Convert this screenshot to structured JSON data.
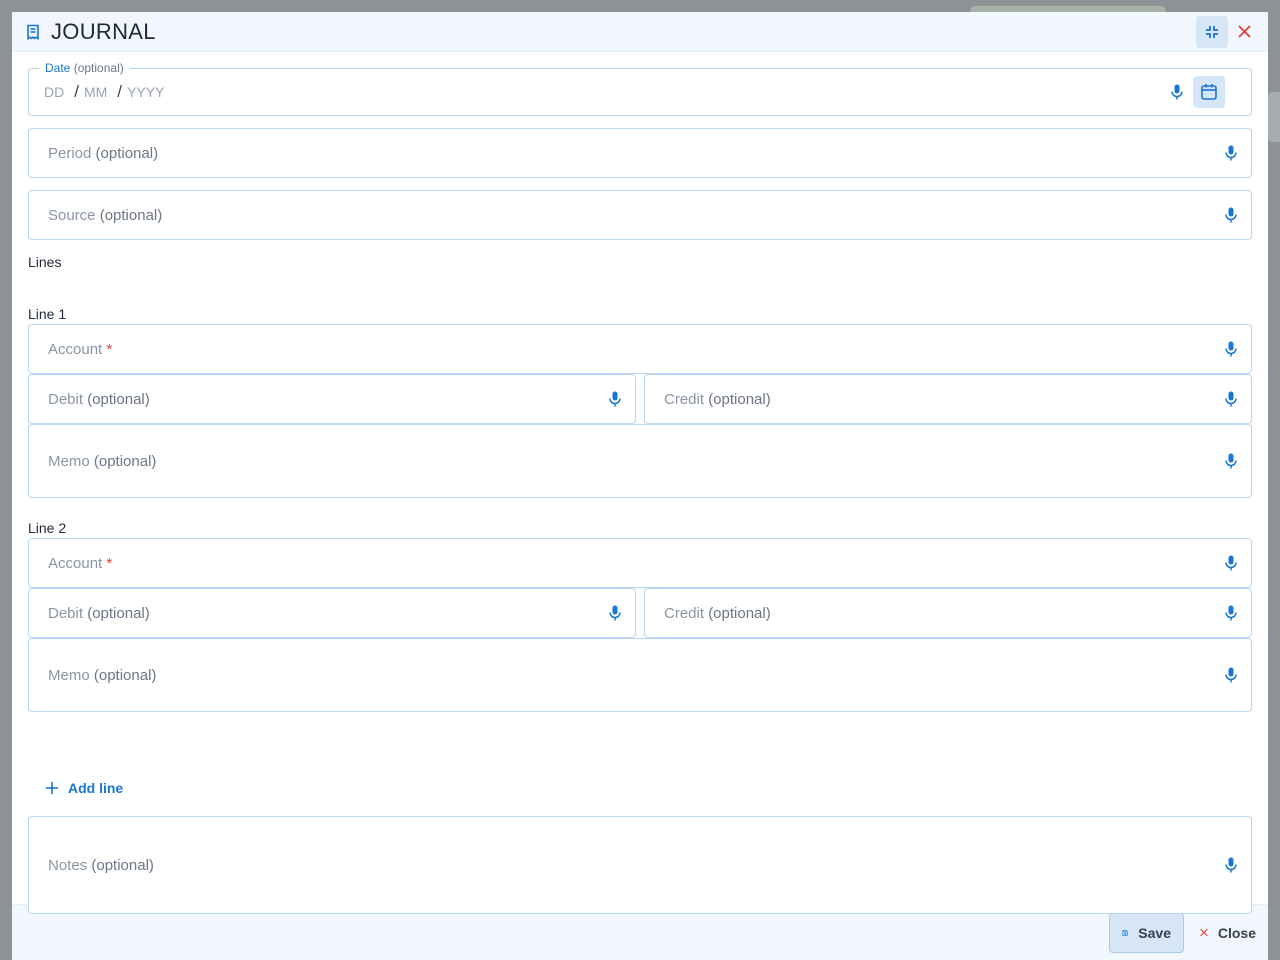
{
  "dialog": {
    "title": "JOURNAL",
    "minimize_icon": "fullscreen-exit-icon",
    "close_icon": "close-icon"
  },
  "date": {
    "label": "Date",
    "optional": "(optional)",
    "dd": "DD",
    "mm": "MM",
    "yyyy": "YYYY",
    "sep": "/"
  },
  "period": {
    "label": "Period",
    "optional": "(optional)"
  },
  "source": {
    "label": "Source",
    "optional": "(optional)"
  },
  "lines_heading": "Lines",
  "lines": [
    {
      "title": "Line 1",
      "account": {
        "label": "Account",
        "required": "*"
      },
      "debit": {
        "label": "Debit",
        "optional": "(optional)"
      },
      "credit": {
        "label": "Credit",
        "optional": "(optional)"
      },
      "memo": {
        "label": "Memo",
        "optional": "(optional)"
      }
    },
    {
      "title": "Line 2",
      "account": {
        "label": "Account",
        "required": "*"
      },
      "debit": {
        "label": "Debit",
        "optional": "(optional)"
      },
      "credit": {
        "label": "Credit",
        "optional": "(optional)"
      },
      "memo": {
        "label": "Memo",
        "optional": "(optional)"
      }
    }
  ],
  "add_line": "Add line",
  "notes": {
    "label": "Notes",
    "optional": "(optional)"
  },
  "footer": {
    "save": "Save",
    "close": "Close"
  },
  "colors": {
    "accent": "#1976d2",
    "danger": "#e53935",
    "header_bg": "#f1f7fd",
    "border": "#b9d7f1"
  }
}
